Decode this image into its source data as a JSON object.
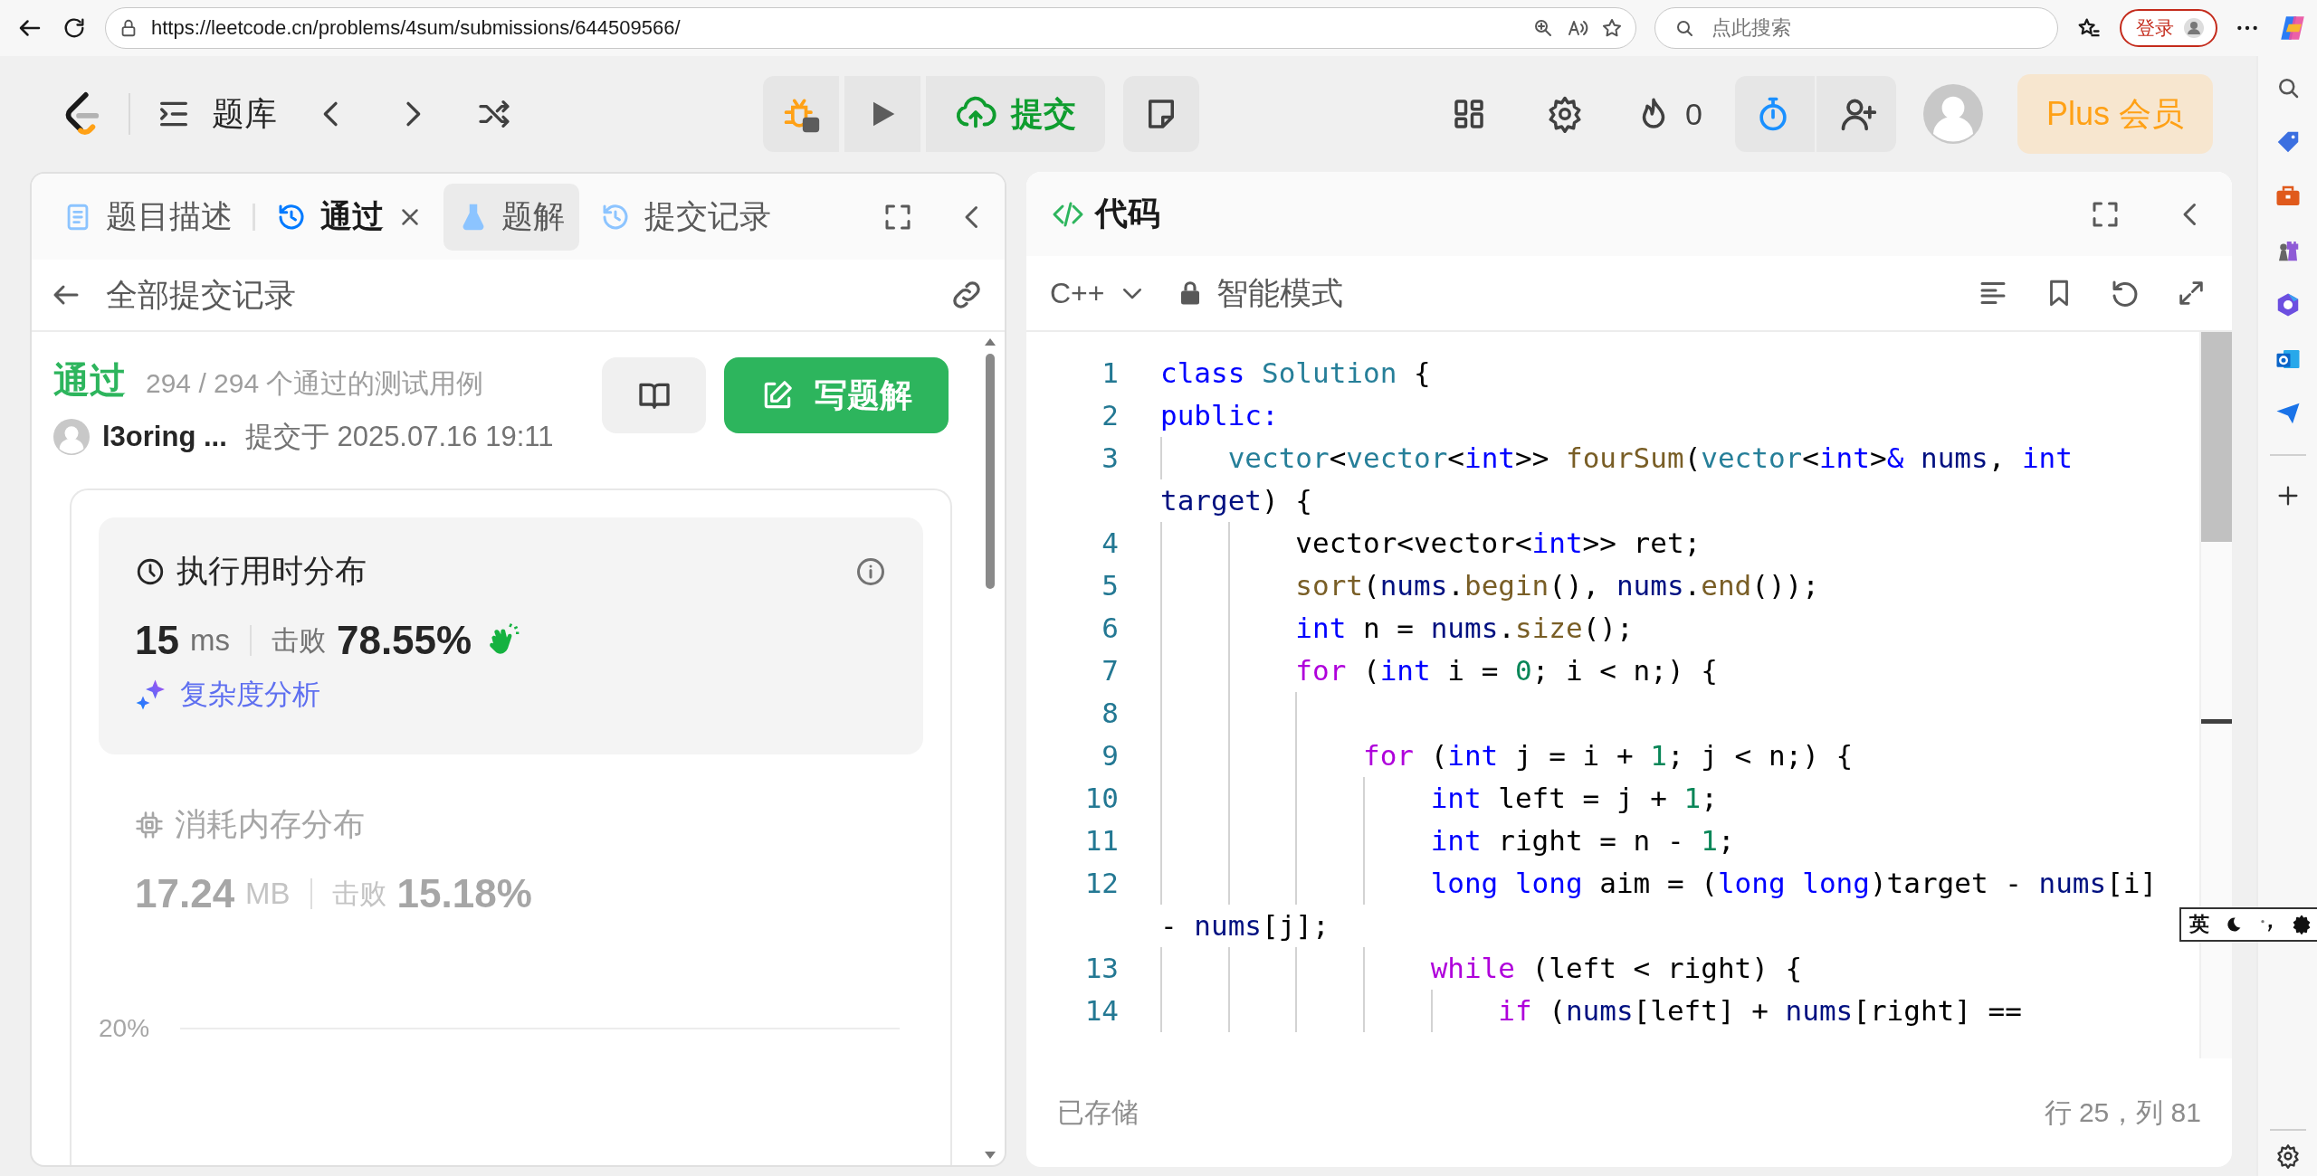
{
  "browser": {
    "url": "https://leetcode.cn/problems/4sum/submissions/644509566/",
    "search_placeholder": "点此搜索",
    "login": "登录"
  },
  "header": {
    "problem_bank": "题库",
    "submit": "提交",
    "streak": "0",
    "plus": "Plus 会员"
  },
  "left_panel": {
    "tabs": [
      {
        "label": "题目描述",
        "kind": "description",
        "selected": false,
        "hovered": false,
        "closable": false
      },
      {
        "label": "通过",
        "kind": "result",
        "selected": true,
        "hovered": false,
        "closable": true
      },
      {
        "label": "题解",
        "kind": "solutions",
        "selected": false,
        "hovered": true,
        "closable": false
      },
      {
        "label": "提交记录",
        "kind": "submissions",
        "selected": false,
        "hovered": false,
        "closable": false
      }
    ],
    "back_title": "全部提交记录",
    "submission": {
      "status": "通过",
      "testcases": "294 / 294 个通过的测试用例",
      "user": "l3oring ...",
      "submitted": "提交于 2025.07.16 19:11",
      "write_solution": "写题解"
    },
    "distributions": [
      {
        "kind": "runtime",
        "title": "执行用时分布",
        "selected": true,
        "value": "15",
        "unit": "ms",
        "beats_label": "击败",
        "beats": "78.55%",
        "analysis_link": "复杂度分析"
      },
      {
        "kind": "memory",
        "title": "消耗内存分布",
        "selected": false,
        "value": "17.24",
        "unit": "MB",
        "beats_label": "击败",
        "beats": "15.18%"
      }
    ],
    "chart": {
      "tick_label": "20%"
    }
  },
  "code_panel": {
    "title": "代码",
    "language": "C++",
    "mode": "智能模式",
    "lines": [
      {
        "number": "1",
        "rows": [
          [
            {
              "text": "class",
              "kind": "kw"
            },
            {
              "text": " ",
              "kind": "plain"
            },
            {
              "text": "Solution",
              "kind": "type"
            },
            {
              "text": " {",
              "kind": "plain"
            }
          ]
        ]
      },
      {
        "number": "2",
        "rows": [
          [
            {
              "text": "public:",
              "kind": "kw"
            }
          ]
        ]
      },
      {
        "number": "3",
        "rows": [
          [
            {
              "text": "    ",
              "kind": "plain"
            },
            {
              "text": "vector",
              "kind": "type"
            },
            {
              "text": "<",
              "kind": "plain"
            },
            {
              "text": "vector",
              "kind": "type"
            },
            {
              "text": "<",
              "kind": "plain"
            },
            {
              "text": "int",
              "kind": "kw"
            },
            {
              "text": ">> ",
              "kind": "plain"
            },
            {
              "text": "fourSum",
              "kind": "fn"
            },
            {
              "text": "(",
              "kind": "plain"
            },
            {
              "text": "vector",
              "kind": "type"
            },
            {
              "text": "<",
              "kind": "plain"
            },
            {
              "text": "int",
              "kind": "kw"
            },
            {
              "text": ">",
              "kind": "plain"
            },
            {
              "text": "&",
              "kind": "kw"
            },
            {
              "text": " ",
              "kind": "plain"
            },
            {
              "text": "nums",
              "kind": "var"
            },
            {
              "text": ", ",
              "kind": "plain"
            },
            {
              "text": "int",
              "kind": "kw"
            }
          ],
          [
            {
              "text": "target",
              "kind": "var"
            },
            {
              "text": ") {",
              "kind": "plain"
            }
          ]
        ]
      },
      {
        "number": "4",
        "rows": [
          [
            {
              "text": "        vector<vector<",
              "kind": "plain"
            },
            {
              "text": "int",
              "kind": "kw"
            },
            {
              "text": ">> ret;",
              "kind": "plain"
            }
          ]
        ]
      },
      {
        "number": "5",
        "rows": [
          [
            {
              "text": "        ",
              "kind": "plain"
            },
            {
              "text": "sort",
              "kind": "fn"
            },
            {
              "text": "(",
              "kind": "plain"
            },
            {
              "text": "nums",
              "kind": "var"
            },
            {
              "text": ".",
              "kind": "plain"
            },
            {
              "text": "begin",
              "kind": "fn"
            },
            {
              "text": "(), ",
              "kind": "plain"
            },
            {
              "text": "nums",
              "kind": "var"
            },
            {
              "text": ".",
              "kind": "plain"
            },
            {
              "text": "end",
              "kind": "fn"
            },
            {
              "text": "());",
              "kind": "plain"
            }
          ]
        ]
      },
      {
        "number": "6",
        "rows": [
          [
            {
              "text": "        ",
              "kind": "plain"
            },
            {
              "text": "int",
              "kind": "kw"
            },
            {
              "text": " n = ",
              "kind": "plain"
            },
            {
              "text": "nums",
              "kind": "var"
            },
            {
              "text": ".",
              "kind": "plain"
            },
            {
              "text": "size",
              "kind": "fn"
            },
            {
              "text": "();",
              "kind": "plain"
            }
          ]
        ]
      },
      {
        "number": "7",
        "rows": [
          [
            {
              "text": "        ",
              "kind": "plain"
            },
            {
              "text": "for",
              "kind": "ctl"
            },
            {
              "text": " (",
              "kind": "plain"
            },
            {
              "text": "int",
              "kind": "kw"
            },
            {
              "text": " i = ",
              "kind": "plain"
            },
            {
              "text": "0",
              "kind": "num"
            },
            {
              "text": "; i < n;) {",
              "kind": "plain"
            }
          ]
        ]
      },
      {
        "number": "8"
      },
      {
        "number": "9",
        "rows": [
          [
            {
              "text": "            ",
              "kind": "plain"
            },
            {
              "text": "for",
              "kind": "ctl"
            },
            {
              "text": " (",
              "kind": "plain"
            },
            {
              "text": "int",
              "kind": "kw"
            },
            {
              "text": " j = i + ",
              "kind": "plain"
            },
            {
              "text": "1",
              "kind": "num"
            },
            {
              "text": "; j < n;) {",
              "kind": "plain"
            }
          ]
        ]
      },
      {
        "number": "10",
        "rows": [
          [
            {
              "text": "                ",
              "kind": "plain"
            },
            {
              "text": "int",
              "kind": "kw"
            },
            {
              "text": " left = j + ",
              "kind": "plain"
            },
            {
              "text": "1",
              "kind": "num"
            },
            {
              "text": ";",
              "kind": "plain"
            }
          ]
        ]
      },
      {
        "number": "11",
        "rows": [
          [
            {
              "text": "                ",
              "kind": "plain"
            },
            {
              "text": "int",
              "kind": "kw"
            },
            {
              "text": " right = n - ",
              "kind": "plain"
            },
            {
              "text": "1",
              "kind": "num"
            },
            {
              "text": ";",
              "kind": "plain"
            }
          ]
        ]
      },
      {
        "number": "12",
        "rows": [
          [
            {
              "text": "                ",
              "kind": "plain"
            },
            {
              "text": "long",
              "kind": "kw"
            },
            {
              "text": " ",
              "kind": "plain"
            },
            {
              "text": "long",
              "kind": "kw"
            },
            {
              "text": " aim = (",
              "kind": "plain"
            },
            {
              "text": "long",
              "kind": "kw"
            },
            {
              "text": " ",
              "kind": "plain"
            },
            {
              "text": "long",
              "kind": "kw"
            },
            {
              "text": ")target - ",
              "kind": "plain"
            },
            {
              "text": "nums",
              "kind": "var"
            },
            {
              "text": "[i]",
              "kind": "plain"
            }
          ],
          [
            {
              "text": "- ",
              "kind": "plain"
            },
            {
              "text": "nums",
              "kind": "var"
            },
            {
              "text": "[j];",
              "kind": "plain"
            }
          ]
        ]
      },
      {
        "number": "13",
        "rows": [
          [
            {
              "text": "                ",
              "kind": "plain"
            },
            {
              "text": "while",
              "kind": "ctl"
            },
            {
              "text": " (left < right) {",
              "kind": "plain"
            }
          ]
        ]
      },
      {
        "number": "14",
        "rows": [
          [
            {
              "text": "                    ",
              "kind": "plain"
            },
            {
              "text": "if",
              "kind": "ctl"
            },
            {
              "text": " (",
              "kind": "plain"
            },
            {
              "text": "nums",
              "kind": "var"
            },
            {
              "text": "[left] + ",
              "kind": "plain"
            },
            {
              "text": "nums",
              "kind": "var"
            },
            {
              "text": "[right] ==",
              "kind": "plain"
            }
          ]
        ]
      }
    ],
    "status": "已存储",
    "cursor": "行 25，列 81"
  },
  "ime_bar": {
    "language": "英"
  }
}
